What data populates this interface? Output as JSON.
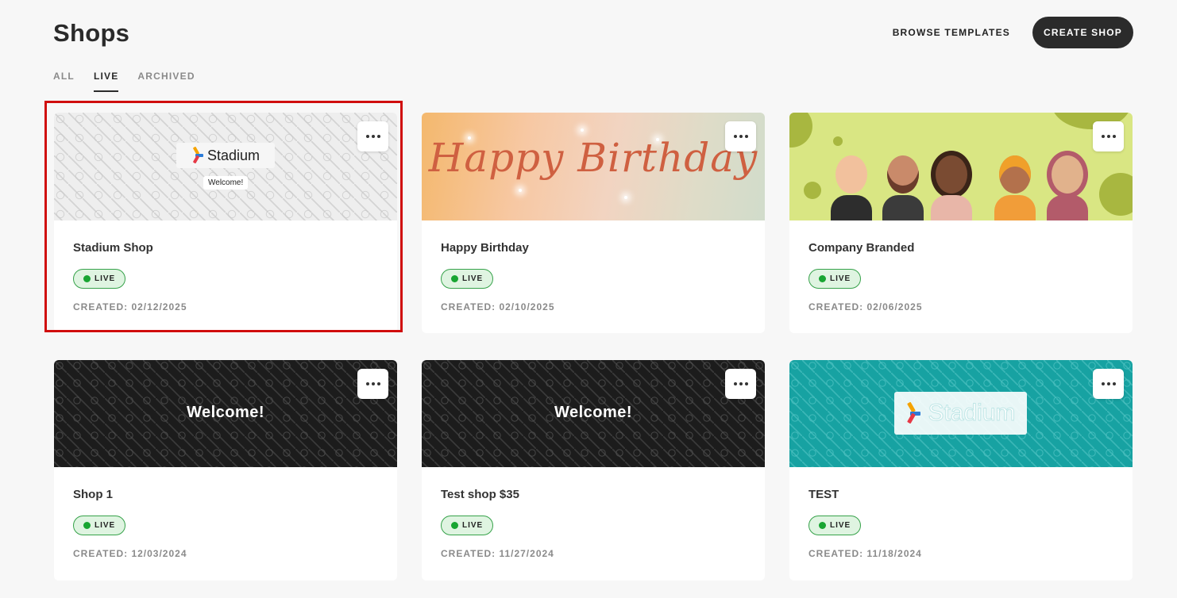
{
  "header": {
    "title": "Shops",
    "browse_label": "BROWSE TEMPLATES",
    "create_label": "CREATE SHOP"
  },
  "tabs": [
    {
      "label": "ALL",
      "active": false
    },
    {
      "label": "LIVE",
      "active": true
    },
    {
      "label": "ARCHIVED",
      "active": false
    }
  ],
  "status_color": "#18a532",
  "highlight_color": "#d00d0d",
  "shops": [
    {
      "name": "Stadium Shop",
      "status": "LIVE",
      "created": "CREATED: 02/12/2025",
      "banner": {
        "style": "stadium-light-pattern",
        "logo_text": "Stadium",
        "caption": "Welcome!"
      },
      "selected": true
    },
    {
      "name": "Happy Birthday",
      "status": "LIVE",
      "created": "CREATED: 02/10/2025",
      "banner": {
        "style": "birthday-gradient",
        "caption": "Happy Birthday"
      }
    },
    {
      "name": "Company Branded",
      "status": "LIVE",
      "created": "CREATED: 02/06/2025",
      "banner": {
        "style": "people-avatars-green"
      }
    },
    {
      "name": "Shop 1",
      "status": "LIVE",
      "created": "CREATED: 12/03/2024",
      "banner": {
        "style": "dark-pattern",
        "caption": "Welcome!"
      }
    },
    {
      "name": "Test shop $35",
      "status": "LIVE",
      "created": "CREATED: 11/27/2024",
      "banner": {
        "style": "dark-pattern",
        "caption": "Welcome!"
      }
    },
    {
      "name": "TEST",
      "status": "LIVE",
      "created": "CREATED: 11/18/2024",
      "banner": {
        "style": "teal-pattern",
        "logo_text": "Stadium"
      }
    }
  ]
}
